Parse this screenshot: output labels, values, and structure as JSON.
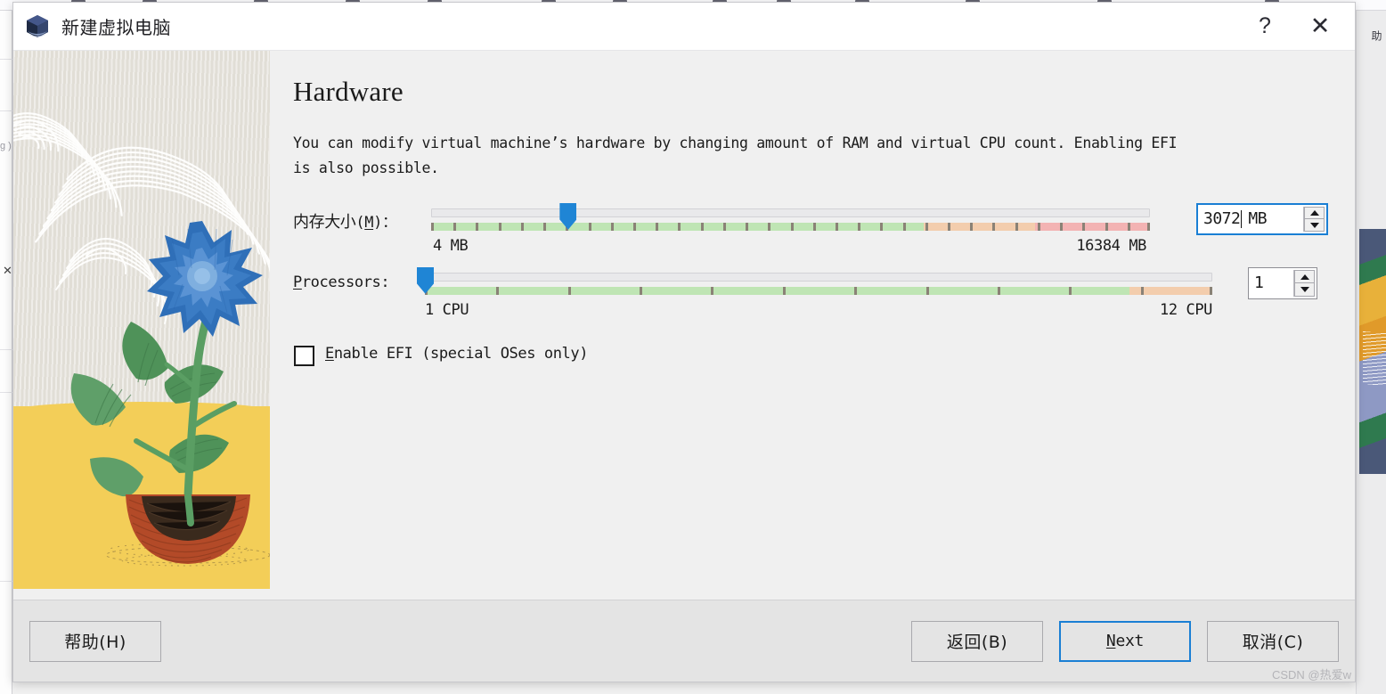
{
  "window": {
    "title": "新建虚拟电脑",
    "icon": "virtualbox-cube-icon",
    "help_label": "?",
    "close_label": "✕"
  },
  "content": {
    "heading": "Hardware",
    "description": "You can modify virtual machine’s hardware by changing amount of RAM and virtual CPU count. Enabling EFI is also possible."
  },
  "memory": {
    "label_cn": "内存大小",
    "label_mnemonic": "M",
    "label_suffix": "：",
    "min_label": "4 MB",
    "max_label": "16384 MB",
    "value": "3072",
    "unit": "MB",
    "min": 4,
    "max": 16384,
    "handle_percent": 19.0,
    "green_end_percent": 68.5,
    "orange_end_percent": 84.0,
    "colors": {
      "green": "#bfe5b4",
      "orange": "#f3cdad",
      "red": "#f3b3b3",
      "tick": "#8a8276",
      "handle": "#1f85d5"
    }
  },
  "processors": {
    "label": "Processors:",
    "label_mnemonic": "P",
    "min_label": "1 CPU",
    "max_label": "12 CPU",
    "value": "1",
    "min": 1,
    "max": 12,
    "handle_percent": 0.0,
    "green_end_percent": 89.5,
    "colors": {
      "green": "#bfe5b4",
      "orange": "#f3cdad",
      "tick": "#8a8276",
      "handle": "#1f85d5"
    }
  },
  "efi": {
    "label": "Enable EFI (special OSes only)",
    "mnemonic": "E",
    "checked": false
  },
  "footer": {
    "help": "帮助(H)",
    "help_mnemonic": "H",
    "back": "返回(B)",
    "back_mnemonic": "B",
    "next": "Next",
    "next_mnemonic": "N",
    "cancel": "取消(C)",
    "cancel_mnemonic": "C",
    "focused_button": "next"
  },
  "watermark": "CSDN @热爱w",
  "background": {
    "left_text_1": "g )",
    "left_close": "✕",
    "right_text": "助"
  },
  "theme": {
    "dialog_bg": "#f0f0f0",
    "titlebar_bg": "#ffffff",
    "footer_bg": "#e4e4e4",
    "accent": "#1a7fd4",
    "illus_bg": "#e7e4dd",
    "illus_ground": "#f3ce58",
    "flower": "#3b7cc4",
    "leaf": "#5a9e63",
    "pot": "#b34a28"
  }
}
